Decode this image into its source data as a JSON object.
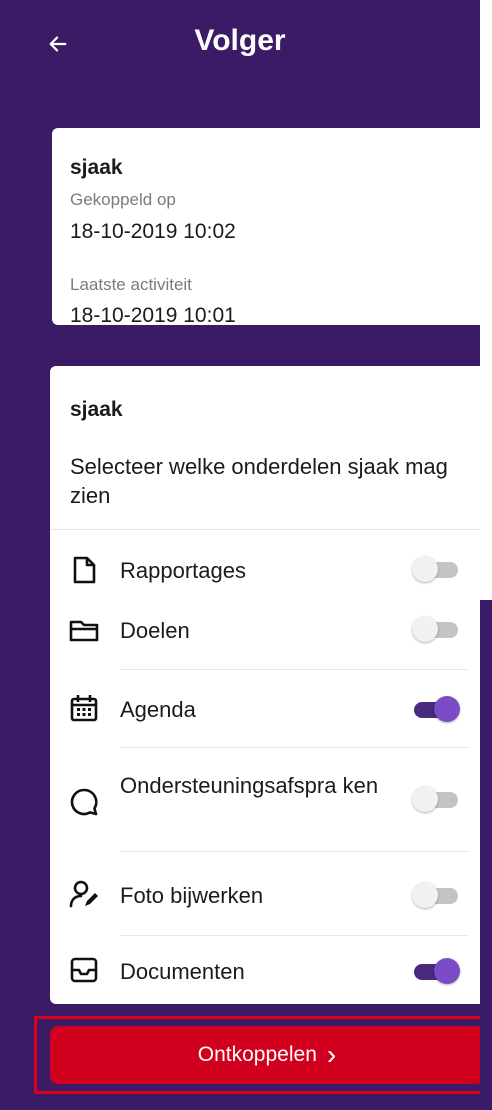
{
  "header": {
    "title": "Volger",
    "back_icon": "arrow-left-icon"
  },
  "follower_card": {
    "name": "sjaak",
    "linked_label": "Gekoppeld op",
    "linked_value": "18-10-2019 10:02",
    "activity_label": "Laatste activiteit",
    "activity_value": "18-10-2019 10:01"
  },
  "permissions_card": {
    "name": "sjaak",
    "description": "Selecteer welke onderdelen sjaak mag zien",
    "items": [
      {
        "label": "Rapportages",
        "icon": "document-icon",
        "enabled": false
      },
      {
        "label": "Doelen",
        "icon": "folder-icon",
        "enabled": false
      },
      {
        "label": "Agenda",
        "icon": "calendar-icon",
        "enabled": true
      },
      {
        "label": "Ondersteuningsafspra ken",
        "icon": "chat-bubble-icon",
        "enabled": false
      },
      {
        "label": "Foto bijwerken",
        "icon": "user-edit-icon",
        "enabled": false
      },
      {
        "label": "Documenten",
        "icon": "inbox-icon",
        "enabled": true
      }
    ]
  },
  "footer": {
    "disconnect_label": "Ontkoppelen",
    "chevron": "›"
  },
  "colors": {
    "background": "#3b1a66",
    "accent": "#7b4bc8",
    "danger": "#d0001e"
  }
}
